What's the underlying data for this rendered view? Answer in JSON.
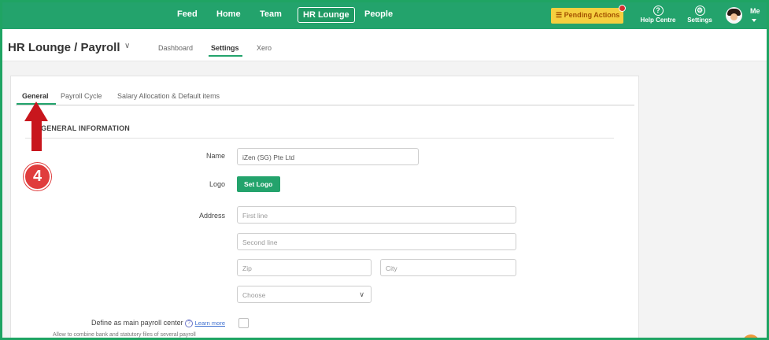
{
  "topnav": {
    "items": [
      "Feed",
      "Home",
      "Team",
      "HR Lounge",
      "People"
    ],
    "active": "HR Lounge",
    "pending_label": "Pending Actions",
    "help_label": "Help Centre",
    "settings_label": "Settings",
    "me_label": "Me",
    "accent_color": "#23a36c"
  },
  "header": {
    "title": "HR Lounge / Payroll",
    "tabs": [
      "Dashboard",
      "Settings",
      "Xero"
    ],
    "active_tab": "Settings"
  },
  "payroll_tabs": {
    "items": [
      "General",
      "Payroll Cycle",
      "Salary Allocation & Default items"
    ],
    "active": "General"
  },
  "section": {
    "title": "GENERAL INFORMATION"
  },
  "form": {
    "name_label": "Name",
    "name_value": "iZen (SG) Pte Ltd",
    "logo_label": "Logo",
    "set_logo_button": "Set Logo",
    "address_label": "Address",
    "first_line_placeholder": "First line",
    "second_line_placeholder": "Second line",
    "zip_placeholder": "Zip",
    "city_placeholder": "City",
    "country_placeholder": "Choose",
    "main_center_label": "Define as main payroll center",
    "learn_more": "Learn more",
    "main_center_note": "Allow to combine bank and statutory files of several payroll"
  },
  "annotation": {
    "step": "4"
  }
}
